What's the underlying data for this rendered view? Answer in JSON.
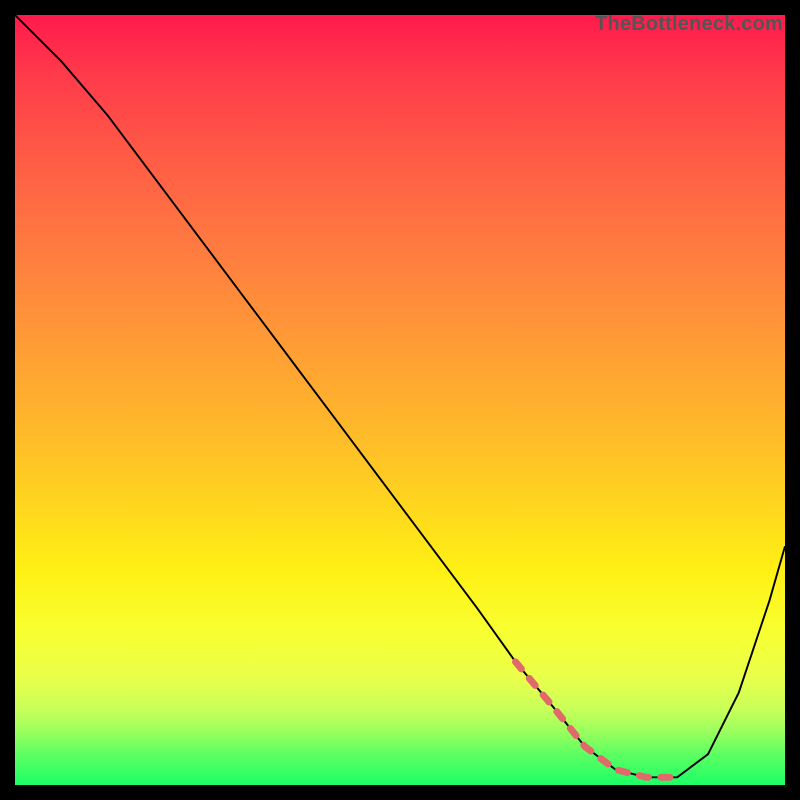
{
  "watermark": "TheBottleneck.com",
  "colors": {
    "background": "#000000",
    "curve_main": "#000000",
    "curve_accent": "#e06a6a",
    "gradient_top": "#ff1a4d",
    "gradient_bottom": "#1cff67"
  },
  "chart_data": {
    "type": "line",
    "title": "",
    "xlabel": "",
    "ylabel": "",
    "xlim": [
      0,
      100
    ],
    "ylim": [
      0,
      100
    ],
    "grid": false,
    "legend": false,
    "series": [
      {
        "name": "bottleneck-curve",
        "x": [
          0,
          6,
          12,
          18,
          24,
          30,
          36,
          42,
          48,
          54,
          60,
          65,
          70,
          74,
          78,
          82,
          86,
          90,
          94,
          98,
          100
        ],
        "values": [
          100,
          94,
          87,
          79,
          71,
          63,
          55,
          47,
          39,
          31,
          23,
          16,
          10,
          5,
          2,
          1,
          1,
          4,
          12,
          24,
          31
        ]
      }
    ],
    "accent_region": {
      "name": "valley-highlight",
      "x_start": 65,
      "x_end": 86
    }
  }
}
